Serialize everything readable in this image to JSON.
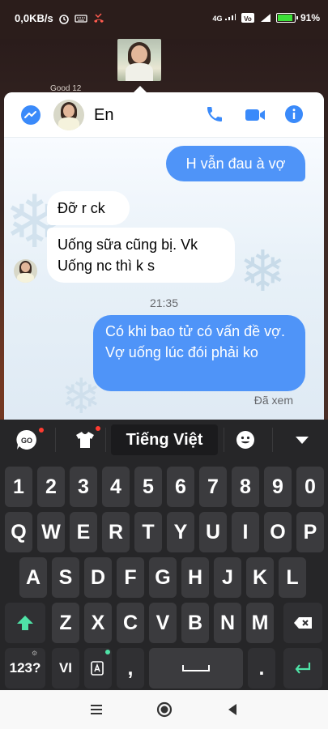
{
  "status_bar": {
    "net_speed": "0,0KB/s",
    "signal_label": "4G",
    "battery_percent": "91%",
    "battery_level": 0.91,
    "battery_color": "#3ce038"
  },
  "chat_head": {
    "ghost_label": "Good 12"
  },
  "chat": {
    "contact_name": "En",
    "accent_color": "#4f94f8",
    "messages": [
      {
        "side": "out",
        "text": "H vẫn đau à vợ"
      },
      {
        "side": "in",
        "text": "Đỡ r ck"
      },
      {
        "side": "in",
        "text": "Uống sữa cũng bị. Vk Uống nc thì k s"
      },
      {
        "side": "out",
        "text": "Có khi bao tử có vấn đề vợ. Vợ uống lúc đói phải ko"
      }
    ],
    "timestamp": "21:35",
    "seen_label": "Đã xem",
    "icons": [
      "messenger-icon",
      "phone-icon",
      "video-call-icon",
      "info-icon"
    ]
  },
  "keyboard": {
    "toolbar": {
      "go_label": "GO",
      "language": "Tiếng Việt",
      "icons": [
        "go-icon",
        "shirt-icon",
        "emoji-icon",
        "collapse-icon"
      ]
    },
    "number_row": [
      "1",
      "2",
      "3",
      "4",
      "5",
      "6",
      "7",
      "8",
      "9",
      "0"
    ],
    "row1": [
      "Q",
      "W",
      "E",
      "R",
      "T",
      "Y",
      "U",
      "I",
      "O",
      "P"
    ],
    "row2": [
      "A",
      "S",
      "D",
      "F",
      "G",
      "H",
      "J",
      "K",
      "L"
    ],
    "row3": [
      "Z",
      "X",
      "C",
      "V",
      "B",
      "N",
      "M"
    ],
    "bottom": {
      "symbols_label": "123?",
      "lang_label": "VI",
      "comma": ",",
      "period": "."
    },
    "key_icons": [
      "shift-icon",
      "backspace-icon",
      "text-input-icon",
      "space-icon",
      "enter-icon"
    ]
  },
  "nav_bar": {
    "icons": [
      "menu-icon",
      "home-icon",
      "back-icon"
    ]
  }
}
